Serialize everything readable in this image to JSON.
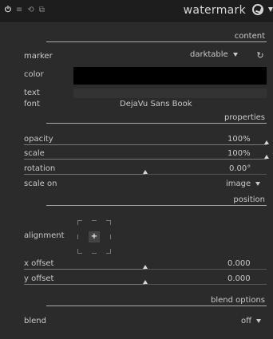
{
  "header": {
    "icons": [
      "power-icon",
      "presets-icon",
      "reset-icon",
      "multi-instance-icon"
    ],
    "title": "watermark"
  },
  "sections": {
    "content": "content",
    "properties": "properties",
    "position": "position",
    "blend_options": "blend options"
  },
  "content": {
    "marker_label": "marker",
    "marker_value": "darktable",
    "color_label": "color",
    "text_label": "text",
    "font_label": "font",
    "font_value": "DejaVu Sans Book"
  },
  "properties": {
    "opacity_label": "opacity",
    "opacity_value": "100%",
    "opacity_level": 1.0,
    "scale_label": "scale",
    "scale_value": "100%",
    "scale_level": 1.0,
    "rotation_label": "rotation",
    "rotation_value": "0.00°",
    "rotation_level": 0.5,
    "scale_on_label": "scale on",
    "scale_on_value": "image"
  },
  "position": {
    "alignment_label": "alignment",
    "alignment_center": "+",
    "x_offset_label": "x offset",
    "x_offset_value": "0.000",
    "x_offset_level": 0.5,
    "y_offset_label": "y offset",
    "y_offset_value": "0.000",
    "y_offset_level": 0.5
  },
  "blend": {
    "label": "blend",
    "value": "off"
  }
}
